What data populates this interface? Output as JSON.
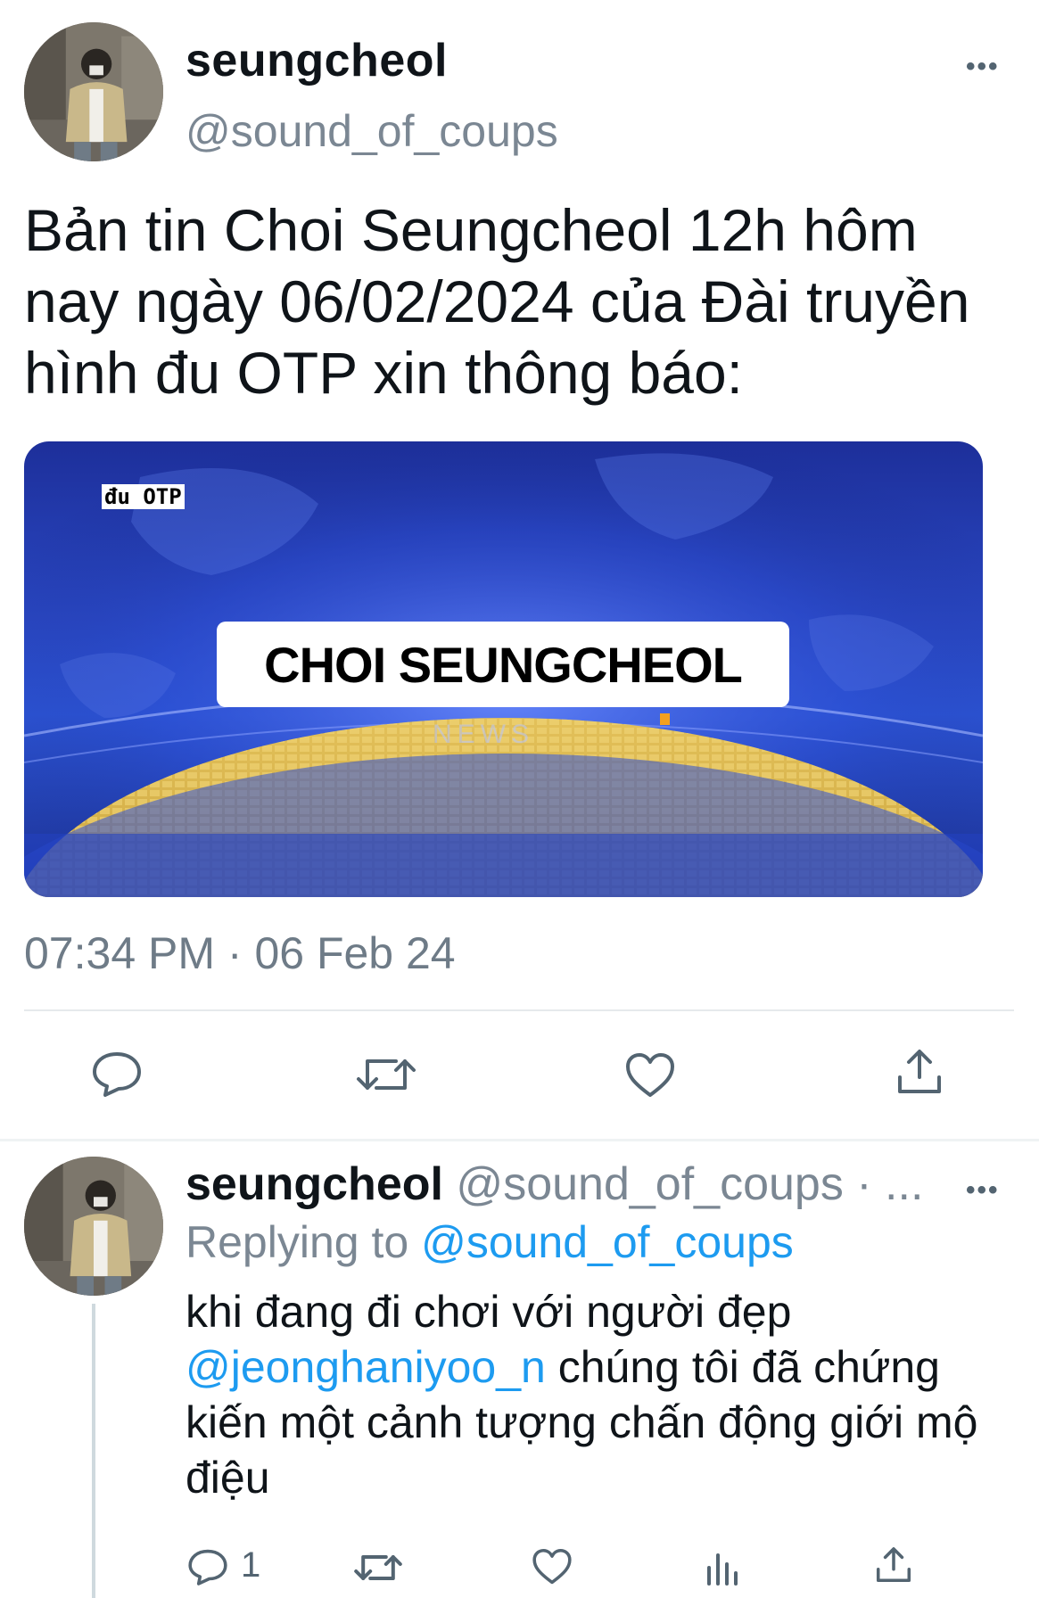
{
  "tweet": {
    "author": {
      "name": "seungcheol",
      "handle": "@sound_of_coups",
      "avatar_icon": "profile-photo"
    },
    "text": "Bản tin Choi Seungcheol 12h hôm nay ngày 06/02/2024 của Đài truyền hình đu OTP xin thông báo:",
    "media": {
      "corner_tag": "đu OTP",
      "headline": "CHOI SEUNGCHEOL",
      "watermark": "NEWS"
    },
    "timestamp": "07:34 PM · 06 Feb 24",
    "more_icon": "more-horizontal-icon",
    "actions": [
      "reply-icon",
      "retweet-icon",
      "like-icon",
      "share-icon"
    ]
  },
  "reply": {
    "author": {
      "name": "seungcheol",
      "handle_and_meta": "@sound_of_coups · ..."
    },
    "replying_prefix": "Replying to",
    "replying_to": "@sound_of_coups",
    "text_line1": "khi đang đi chơi với người đẹp",
    "mention": "@jeonghaniyoo_n",
    "text_rest": " chúng tôi đã chứng kiến một cảnh tượng chấn động giới mộ điệu",
    "reply_count": "1",
    "actions": [
      "reply-icon",
      "retweet-icon",
      "like-icon",
      "analytics-icon",
      "share-icon"
    ]
  },
  "colors": {
    "text": "#0f1419",
    "secondary": "#7b8793",
    "link": "#1d9bf0",
    "divider": "#e6e9ec"
  }
}
